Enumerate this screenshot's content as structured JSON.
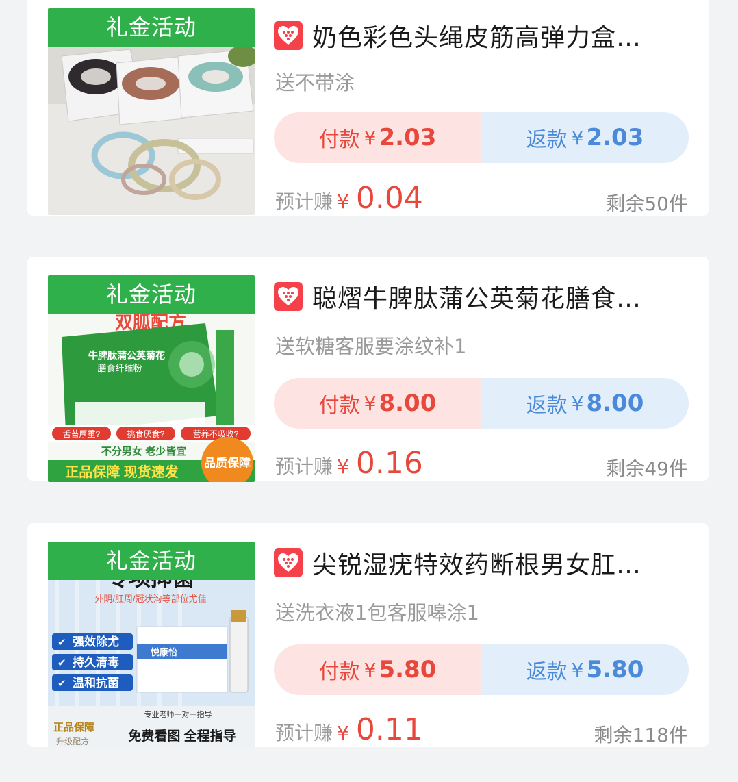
{
  "products": [
    {
      "promo_label": "礼金活动",
      "title": "奶色彩色头绳皮筋高弹力盒…",
      "subtitle": "送不带涂",
      "pay_label": "付款",
      "pay_currency": "¥",
      "pay_value": "2.03",
      "refund_label": "返款",
      "refund_currency": "¥",
      "refund_value": "2.03",
      "earn_label": "预计赚",
      "earn_currency": "¥",
      "earn_value": "0.04",
      "stock": "剩余50件"
    },
    {
      "promo_label": "礼金活动",
      "title": "聪熠牛脾肽蒲公英菊花膳食…",
      "subtitle": "送软糖客服要涂纹补1",
      "pay_label": "付款",
      "pay_currency": "¥",
      "pay_value": "8.00",
      "refund_label": "返款",
      "refund_currency": "¥",
      "refund_value": "8.00",
      "earn_label": "预计赚",
      "earn_currency": "¥",
      "earn_value": "0.16",
      "stock": "剩余49件",
      "image_text": {
        "top": "双胍配方",
        "box_title": "牛脾肽蒲公英菊花",
        "box_sub": "膳食纤维粉",
        "q1": "舌苔厚重?",
        "q2": "挑食厌食?",
        "q3": "营养不吸收?",
        "tag": "不分男女 老少皆宜",
        "bottom": "正品保障 现货速发",
        "seal": "品质保障"
      }
    },
    {
      "promo_label": "礼金活动",
      "title": "尖锐湿疣特效药断根男女肛…",
      "subtitle": "送洗衣液1包客服嗥涂1",
      "pay_label": "付款",
      "pay_currency": "¥",
      "pay_value": "5.80",
      "refund_label": "返款",
      "refund_currency": "¥",
      "refund_value": "5.80",
      "earn_label": "预计赚",
      "earn_currency": "¥",
      "earn_value": "0.11",
      "stock": "剩余118件",
      "image_text": {
        "headline": "专项抑菌",
        "sub": "外阴/肛周/冠状沟等部位尤佳",
        "check1": "强效除尤",
        "check2": "持久清毒",
        "check3": "温和抗菌",
        "brand": "悦康怡",
        "teacher": "专业老师一对一指导",
        "guarantee": "正品保障",
        "formula": "升级配方",
        "guide": "免费看图 全程指导"
      }
    }
  ],
  "colors": {
    "promo_green": "#2fb04a",
    "pay_red": "#e8483c",
    "refund_blue": "#4a8ad8",
    "badge_red": "#f4414a"
  },
  "icons": {
    "badge": "heart-badge-icon",
    "check": "check-icon"
  }
}
